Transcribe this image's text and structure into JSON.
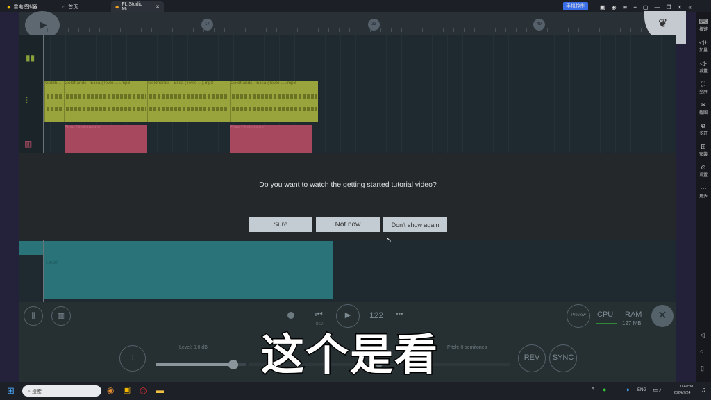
{
  "topbar": {
    "app_name": "雷电模拟器",
    "home_tab": "首页",
    "active_tab": "FL Studio Mo...",
    "phone_control": "手机控制"
  },
  "sidepanel": [
    {
      "icon": "keyboard-icon",
      "label": "按键"
    },
    {
      "icon": "volume-up-icon",
      "label": "加量"
    },
    {
      "icon": "volume-down-icon",
      "label": "减量"
    },
    {
      "icon": "fullscreen-icon",
      "label": "全屏"
    },
    {
      "icon": "scissors-icon",
      "label": "截图"
    },
    {
      "icon": "multi-open-icon",
      "label": "多开"
    },
    {
      "icon": "install-icon",
      "label": "安装"
    },
    {
      "icon": "settings-icon",
      "label": "设置"
    },
    {
      "icon": "more-icon",
      "label": "更多"
    }
  ],
  "ruler": {
    "bars": [
      "17",
      "33",
      "49"
    ]
  },
  "clips": {
    "audio_short": "Goldh...",
    "audio": "Goldhands - Elisa (Tevlo ...).mp3",
    "pattern": "Flute Diminuendo",
    "automation": "Level"
  },
  "dialog": {
    "question": "Do you want to watch the getting started tutorial video?",
    "sure": "Sure",
    "not_now": "Not now",
    "dont_show": "Don't show again"
  },
  "controls": {
    "tempo": "122",
    "prev_label": "REV",
    "preview": "Preview",
    "cpu": "CPU",
    "ram": "RAM",
    "ram_value": "127 MB",
    "level": "Level: 0.0 dB",
    "pitch": "Pitch: 0 semitones",
    "rev": "REV",
    "sync": "SYNC",
    "level_fraction": 0.85,
    "pitch_fraction": 0.5
  },
  "subtitle": "这个是看",
  "taskbar": {
    "search_placeholder": "搜索",
    "lang": "ENG",
    "time": "0:40:38",
    "date": "2024/7/24"
  },
  "colors": {
    "audio_clip": "#9aa43c",
    "pattern_clip": "#a8485f",
    "automation_clip": "#2a7479",
    "accent": "#3a6ee8"
  }
}
